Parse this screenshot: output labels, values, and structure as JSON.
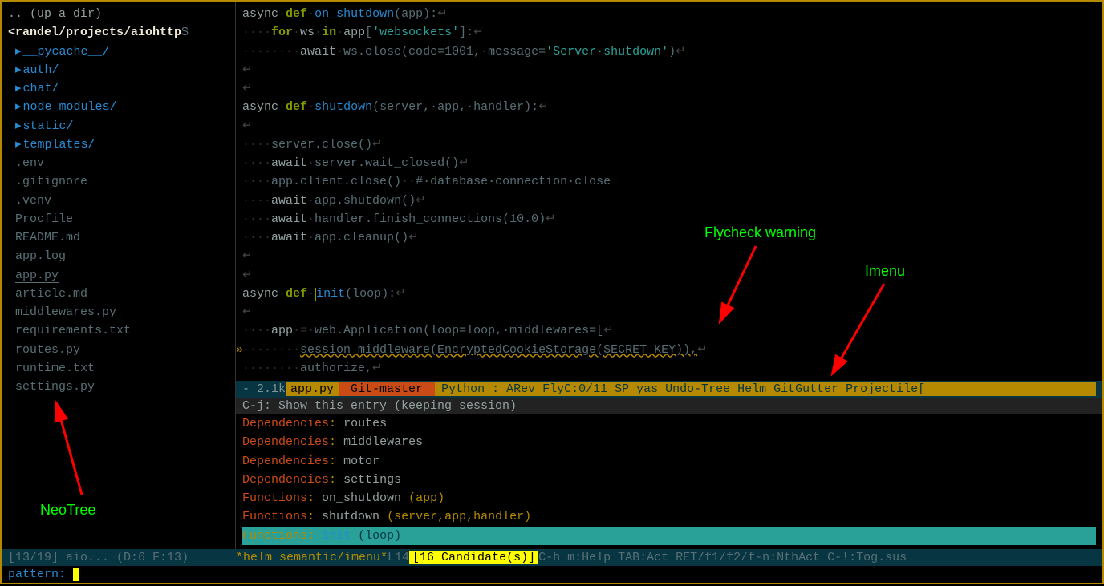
{
  "sidebar": {
    "up_dir": ".. (up a dir)",
    "path": "<randel/projects/aiohttp",
    "dollar": "$",
    "folders": [
      "__pycache__/",
      "auth/",
      "chat/",
      "node_modules/",
      "static/",
      "templates/"
    ],
    "files": [
      ".env",
      ".gitignore",
      ".venv",
      "Procfile",
      "README.md",
      "app.log",
      "app.py",
      "article.md",
      "middlewares.py",
      "requirements.txt",
      "routes.py",
      "runtime.txt",
      "settings.py"
    ],
    "selected_file_index": 6
  },
  "code": {
    "lines": [
      {
        "type": "def",
        "async": "async",
        "def": "def",
        "name": "on_shutdown",
        "params": "(app):"
      },
      {
        "type": "for",
        "indent": 4,
        "for": "for",
        "var": "ws",
        "in": "in",
        "iter": "app",
        "idx_open": "[",
        "idx_str": "'websockets'",
        "idx_close": "]:"
      },
      {
        "type": "await",
        "indent": 8,
        "await": "await",
        "call": "ws.close(code=1001,",
        "dot": "·",
        "kw": "message=",
        "str": "'Server·shutdown'",
        "close": ")"
      },
      {
        "type": "blank"
      },
      {
        "type": "blank"
      },
      {
        "type": "def",
        "async": "async",
        "def": "def",
        "name": "shutdown",
        "params": "(server,·app,·handler):"
      },
      {
        "type": "blank"
      },
      {
        "type": "stmt",
        "indent": 4,
        "text": "server.close()"
      },
      {
        "type": "await",
        "indent": 4,
        "await": "await",
        "call": "server.wait_closed()"
      },
      {
        "type": "stmt_comment",
        "indent": 4,
        "text": "app.client.close()",
        "ws": "··",
        "comment": "#·database·connection·close"
      },
      {
        "type": "await",
        "indent": 4,
        "await": "await",
        "call": "app.shutdown()"
      },
      {
        "type": "await",
        "indent": 4,
        "await": "await",
        "call": "handler.finish_connections(10.0)"
      },
      {
        "type": "await",
        "indent": 4,
        "await": "await",
        "call": "app.cleanup()"
      },
      {
        "type": "blank"
      },
      {
        "type": "blank"
      },
      {
        "type": "def_cursor",
        "async": "async",
        "def": "def",
        "name": "init",
        "params": "(loop):"
      },
      {
        "type": "blank"
      },
      {
        "type": "assign",
        "indent": 4,
        "var": "app",
        "eq": "·=·",
        "call": "web.Application(loop=loop,·middlewares=["
      },
      {
        "type": "err",
        "indent": 8,
        "gutter": "»",
        "text": "session_middleware(EncryptedCookieStorage(SECRET_KEY)),"
      },
      {
        "type": "cont",
        "indent": 8,
        "text": "authorize,"
      }
    ]
  },
  "modeline": {
    "prefix": "- 2.1k  ",
    "filename": "app.py",
    "git": "Git-master",
    "rest": " Python : ARev FlyC:0/11 SP yas Undo-Tree Helm GitGutter Projectile["
  },
  "helm": {
    "hint": "C-j: Show this entry (keeping session)",
    "items": [
      {
        "cat": "Dependencies",
        "val": "routes"
      },
      {
        "cat": "Dependencies",
        "val": "middlewares"
      },
      {
        "cat": "Dependencies",
        "val": "motor"
      },
      {
        "cat": "Dependencies",
        "val": "settings"
      },
      {
        "cat": "Functions",
        "val": "on_shutdown",
        "args": "(app)"
      },
      {
        "cat": "Functions",
        "val": "shutdown",
        "args": "(server,app,handler)"
      },
      {
        "cat": "Functions",
        "val": "init",
        "args": "(loop)",
        "selected": true
      }
    ]
  },
  "bottom": {
    "sidebar_status": "[13/19] aio... (D:6 F:13)",
    "buffer": "*helm semantic/imenu*",
    "line": " L14  ",
    "candidates": "[16 Candidate(s)]",
    "help": "  C-h m:Help TAB:Act RET/f1/f2/f-n:NthAct C-!:Tog.sus"
  },
  "minibuffer": {
    "label": "pattern: "
  },
  "annotations": {
    "neotree": "NeoTree",
    "flycheck": "Flycheck warning",
    "imenu": "Imenu"
  }
}
